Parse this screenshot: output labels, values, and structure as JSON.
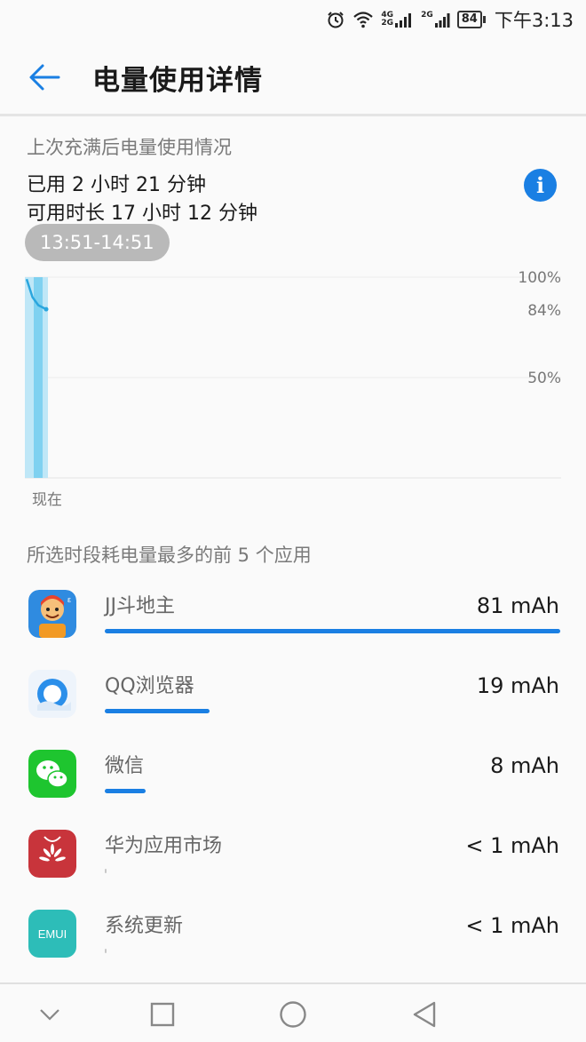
{
  "status_bar": {
    "network_1": "4G",
    "network_1b": "2G",
    "network_2": "2G",
    "battery_level": "84",
    "time": "下午3:13"
  },
  "header": {
    "title": "电量使用详情"
  },
  "summary": {
    "section_title": "上次充满后电量使用情况",
    "used_line": "已用 2 小时 21 分钟",
    "remaining_line": "可用时长 17 小时 12 分钟",
    "time_range": "13:51-14:51"
  },
  "chart_data": {
    "type": "area",
    "y_ticks": [
      "100%",
      "84%",
      "50%"
    ],
    "x_label": "现在",
    "points": [
      {
        "t": 0.0,
        "y": 99
      },
      {
        "t": 0.1,
        "y": 96
      },
      {
        "t": 0.3,
        "y": 90
      },
      {
        "t": 0.6,
        "y": 86
      },
      {
        "t": 1.0,
        "y": 84
      }
    ],
    "ylim": [
      0,
      100
    ],
    "grid": true,
    "line_color": "#2aa6de",
    "fill_color": "#bfe7f7"
  },
  "apps": {
    "header": "所选时段耗电量最多的前 5 个应用",
    "items": [
      {
        "name": "JJ斗地主",
        "value": "81 mAh",
        "share": 1.0
      },
      {
        "name": "QQ浏览器",
        "value": "19 mAh",
        "share": 0.23
      },
      {
        "name": "微信",
        "value": "8 mAh",
        "share": 0.09
      },
      {
        "name": "华为应用市场",
        "value": "< 1 mAh",
        "share": 0.004
      },
      {
        "name": "系统更新",
        "value": "< 1 mAh",
        "share": 0.004
      }
    ],
    "emui_logo_text": "EMUI"
  },
  "colors": {
    "accent": "#1a7fe3",
    "chart_line": "#2aa6de",
    "chart_fill": "#bfe7f7",
    "pill_bg": "#b9b9b9"
  },
  "icons": {
    "back": "arrow-left-icon",
    "info": "info-icon",
    "alarm": "alarm-icon",
    "wifi": "wifi-icon",
    "nav_down": "chevron-down-icon",
    "nav_recents": "square-icon",
    "nav_home": "circle-icon",
    "nav_back": "triangle-back-icon"
  }
}
